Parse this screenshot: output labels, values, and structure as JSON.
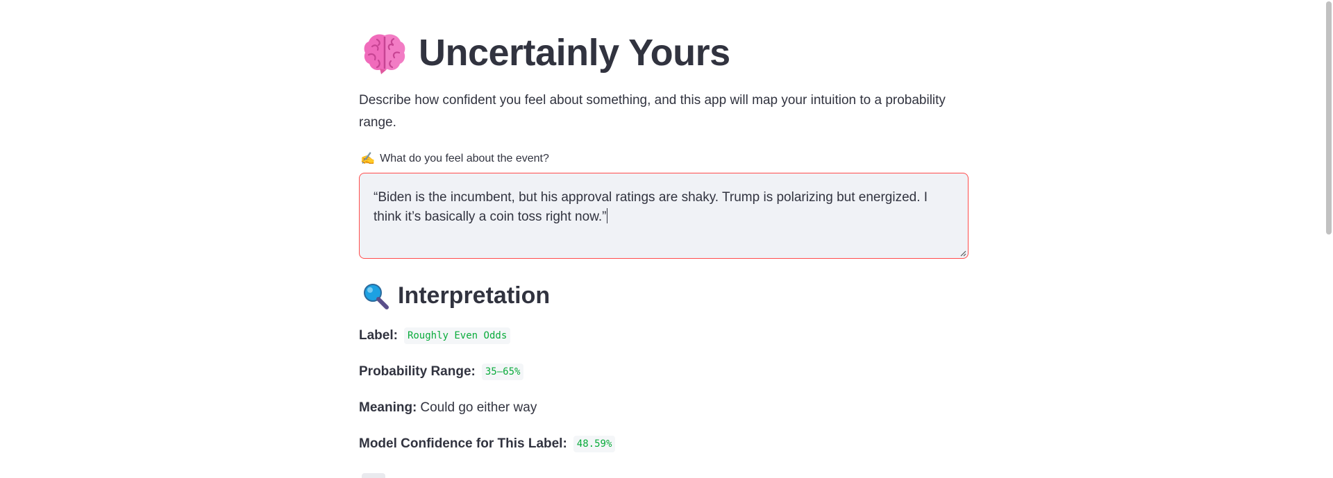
{
  "header": {
    "icon": "brain-icon",
    "title": "Uncertainly Yours"
  },
  "description": "Describe how confident you feel about something, and this app will map your intuition to a probability range.",
  "input": {
    "label_icon": "writing-hand-icon",
    "label": "What do you feel about the event?",
    "value": "“Biden is the incumbent, but his approval ratings are shaky. Trump is polarizing but energized. I think it’s basically a coin toss right now.”"
  },
  "interpretation": {
    "icon": "magnifying-glass-icon",
    "title": "Interpretation",
    "label_key": "Label:",
    "label_value": "Roughly Even Odds",
    "range_key": "Probability Range:",
    "range_value": "35–65%",
    "meaning_key": "Meaning:",
    "meaning_value": "Could go either way",
    "confidence_key": "Model Confidence for This Label:",
    "confidence_value": "48.59%"
  },
  "colors": {
    "text": "#31333f",
    "accent_border": "#ff4b4b",
    "input_bg": "#f0f2f6",
    "code_green": "#09ab3b"
  }
}
